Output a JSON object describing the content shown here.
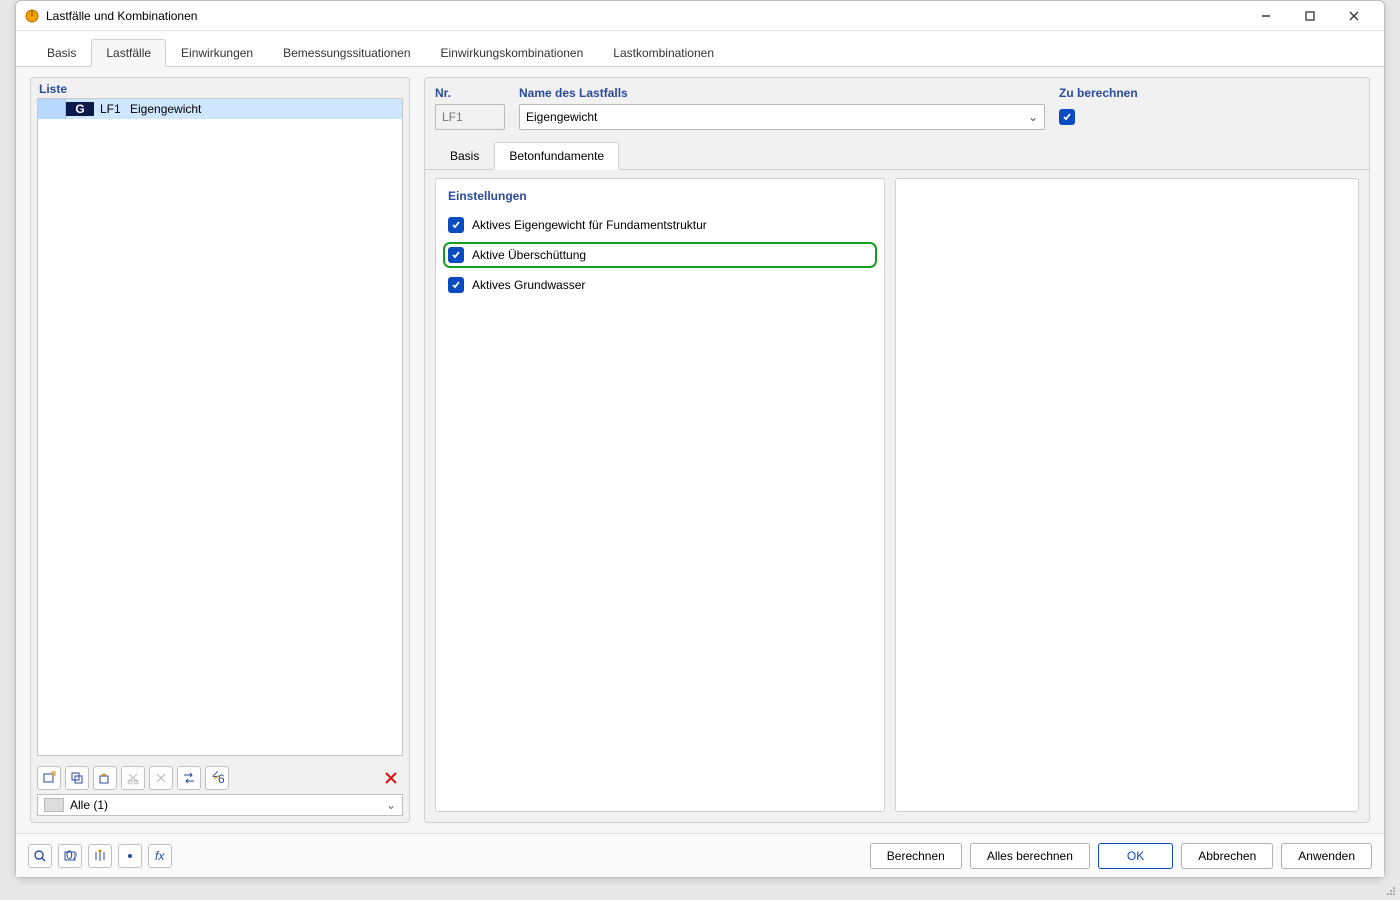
{
  "window": {
    "title": "Lastfälle und Kombinationen"
  },
  "tabs": [
    {
      "label": "Basis"
    },
    {
      "label": "Lastfälle"
    },
    {
      "label": "Einwirkungen"
    },
    {
      "label": "Bemessungssituationen"
    },
    {
      "label": "Einwirkungskombinationen"
    },
    {
      "label": "Lastkombinationen"
    }
  ],
  "active_tab": 1,
  "list": {
    "heading": "Liste",
    "items": [
      {
        "badge": "G",
        "code": "LF1",
        "name": "Eigengewicht"
      }
    ]
  },
  "list_filter": {
    "label": "Alle (1)"
  },
  "detail": {
    "nr_label": "Nr.",
    "nr_value": "LF1",
    "name_label": "Name des Lastfalls",
    "name_value": "Eigengewicht",
    "calc_label": "Zu berechnen",
    "calc_checked": true
  },
  "subtabs": [
    {
      "label": "Basis"
    },
    {
      "label": "Betonfundamente"
    }
  ],
  "active_subtab": 1,
  "settings": {
    "heading": "Einstellungen",
    "items": [
      {
        "label": "Aktives Eigengewicht für Fundamentstruktur",
        "checked": true,
        "highlight": false
      },
      {
        "label": "Aktive Überschüttung",
        "checked": true,
        "highlight": true
      },
      {
        "label": "Aktives Grundwasser",
        "checked": true,
        "highlight": false
      }
    ]
  },
  "footer": {
    "calc": "Berechnen",
    "calc_all": "Alles berechnen",
    "ok": "OK",
    "cancel": "Abbrechen",
    "apply": "Anwenden"
  }
}
